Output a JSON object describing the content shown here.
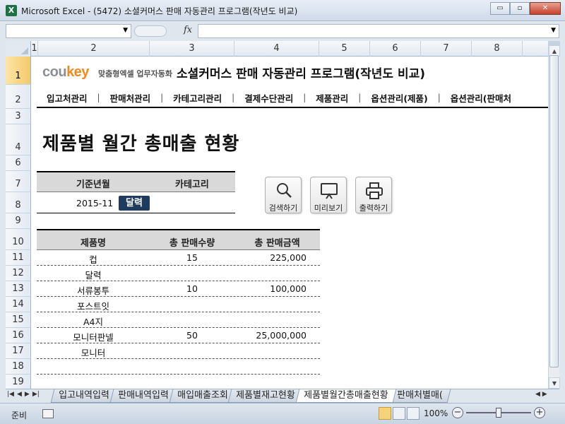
{
  "window": {
    "title": "Microsoft Excel - (5472) 소셜커머스 판매 자동관리 프로그램(작년도 비교)",
    "app_icon": "excel-icon",
    "controls": {
      "minimize": "▭",
      "restore": "▫",
      "close": "✕"
    }
  },
  "formula_bar": {
    "name_box": "",
    "fx_label": "fx",
    "formula": ""
  },
  "columns": [
    "1",
    "2",
    "3",
    "4",
    "5",
    "6",
    "7",
    "8"
  ],
  "rows": [
    "1",
    "2",
    "3",
    "4",
    "6",
    "7",
    "8",
    "9",
    "10",
    "11",
    "12",
    "13",
    "14",
    "15",
    "16",
    "17",
    "18",
    "19"
  ],
  "selected_row": "1",
  "brand": {
    "logo_a": "cou",
    "logo_b": "key",
    "tagline": "맞춤형엑셀 업무자동화"
  },
  "app_title": "소셜커머스 판매 자동관리 프로그램(작년도 비교)",
  "nav": [
    "입고처관리",
    "판매처관리",
    "카테고리관리",
    "결제수단관리",
    "제품관리",
    "옵션관리(제품)",
    "옵션관리(판매처"
  ],
  "nav_separator": "|",
  "page_heading": "제품별 월간 총매출 현황",
  "filter": {
    "period_label": "기준년월",
    "category_label": "카테고리",
    "period_value": "2015-11",
    "calendar_button": "달력",
    "category_value": ""
  },
  "toolbar": {
    "search": "검색하기",
    "preview": "미리보기",
    "print": "출력하기"
  },
  "table": {
    "headers": [
      "제품명",
      "총 판매수량",
      "총 판매금액"
    ],
    "rows": [
      [
        "컵",
        "15",
        "225,000"
      ],
      [
        "달력",
        "",
        ""
      ],
      [
        "서류봉투",
        "10",
        "100,000"
      ],
      [
        "포스트잇",
        "",
        ""
      ],
      [
        "A4지",
        "",
        ""
      ],
      [
        "모니터판넬",
        "50",
        "25,000,000"
      ],
      [
        "모니터",
        "",
        ""
      ],
      [
        "",
        "",
        ""
      ],
      [
        "",
        "",
        ""
      ]
    ]
  },
  "sheet_tabs": [
    "입고내역입력",
    "판매내역입력",
    "매입매출조회",
    "제품별재고현황",
    "제품별월간총매출현황",
    "판매처별매("
  ],
  "active_tab": "제품별월간총매출현황",
  "status": {
    "ready": "준비",
    "zoom": "100%"
  }
}
